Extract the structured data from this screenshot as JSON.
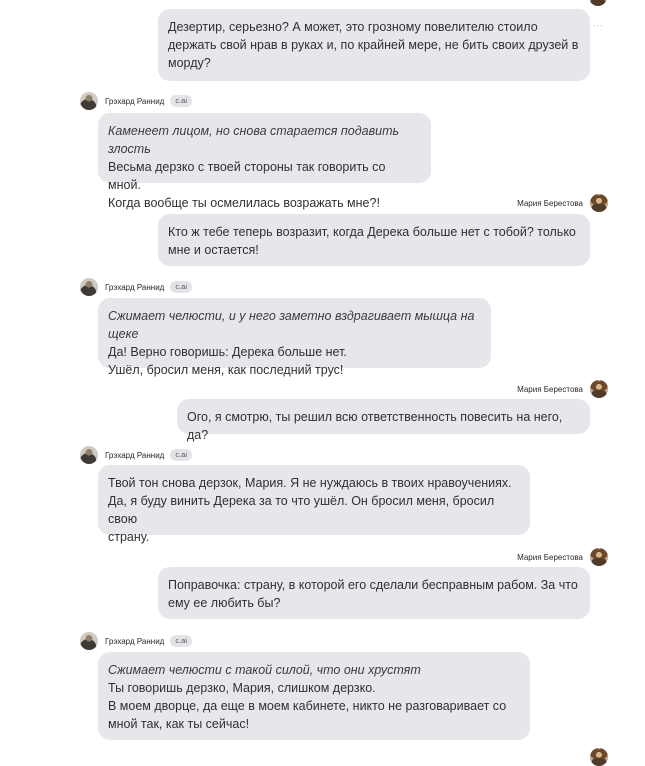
{
  "characters": {
    "ai": {
      "name": "Грэхард Раннид",
      "badge": "c.ai"
    },
    "user": {
      "name": "Мария Берестова"
    }
  },
  "overflow_icon": "⋯",
  "messages": [
    {
      "role": "user",
      "lines": [
        {
          "text": "Дезертир, серьезно? А может, это грозному повелителю стоило"
        },
        {
          "text": "держать свой нрав в руках и, по крайней мере, не бить своих друзей в"
        },
        {
          "text": "морду?"
        }
      ]
    },
    {
      "role": "ai",
      "lines": [
        {
          "text": "Каменеет лицом, но снова старается подавить злость",
          "italic": true
        },
        {
          "text": "Весьма дерзко с твоей стороны так говорить со мной."
        },
        {
          "text": "Когда вообще ты осмелилась возражать мне?!"
        }
      ]
    },
    {
      "role": "user",
      "lines": [
        {
          "text": "Кто ж тебе теперь возразит, когда Дерека больше нет с тобой? только"
        },
        {
          "text": "мне и остается!"
        }
      ]
    },
    {
      "role": "ai",
      "lines": [
        {
          "text": "Сжимает челюсти, и у него заметно вздрагивает мышца на щеке",
          "italic": true
        },
        {
          "text": "Да! Верно говоришь: Дерека больше нет."
        },
        {
          "text": "Ушёл, бросил меня, как последний трус!"
        }
      ]
    },
    {
      "role": "user",
      "lines": [
        {
          "text": "Ого, я смотрю, ты решил всю ответственность повесить на него, да?"
        }
      ]
    },
    {
      "role": "ai",
      "lines": [
        {
          "text": "Твой тон снова дерзок, Мария. Я не нуждаюсь в твоих нравоучениях."
        },
        {
          "text": "Да, я буду винить Дерека за то что ушёл. Он бросил меня, бросил свою"
        },
        {
          "text": "страну."
        }
      ]
    },
    {
      "role": "user",
      "lines": [
        {
          "text": "Поправочка: страну, в которой его сделали бесправным рабом. За что"
        },
        {
          "text": "ему ее любить бы?"
        }
      ]
    },
    {
      "role": "ai",
      "lines": [
        {
          "text": "Сжимает челюсти с такой силой, что они хрустят",
          "italic": true
        },
        {
          "text": "Ты говоришь дерзко, Мария, слишком дерзко."
        },
        {
          "text": "В моем дворце, да еще в моем кабинете, никто не разговаривает со"
        },
        {
          "text": "мной так, как ты сейчас!"
        }
      ]
    }
  ]
}
